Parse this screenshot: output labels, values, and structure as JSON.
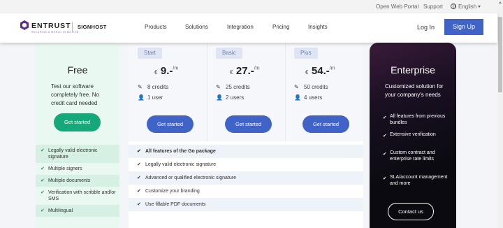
{
  "utility_bar": {
    "open_web_portal": "Open Web Portal",
    "support": "Support",
    "language": "English"
  },
  "header": {
    "brand": "ENTRUST",
    "brand_tagline": "SECURING A WORLD IN MOTION",
    "product": "SIGNHOST",
    "nav": [
      "Products",
      "Solutions",
      "Integration",
      "Pricing",
      "Insights"
    ],
    "login": "Log In",
    "signup": "Sign Up"
  },
  "free_plan": {
    "title": "Free",
    "description": "Test our software completely free. No credit card needed",
    "button": "Get started",
    "features": [
      "Legally valid electronic signature",
      "Multiple signers",
      "Multiple documents",
      "Verification with scribble and/or SMS",
      "Multilingual"
    ]
  },
  "paid_plans": [
    {
      "name": "Start",
      "currency": "€",
      "price": "9.-",
      "period": "/m",
      "credits": "8 credits",
      "users": "1 user",
      "button": "Get started"
    },
    {
      "name": "Basic",
      "currency": "€",
      "price": "27.-",
      "period": "/m",
      "credits": "25 credits",
      "users": "2 users",
      "button": "Get started"
    },
    {
      "name": "Plus",
      "currency": "€",
      "price": "54.-",
      "period": "/m",
      "credits": "50 credits",
      "users": "4 users",
      "button": "Get started"
    }
  ],
  "paid_features": [
    "All features of the Go package",
    "Legally valid electronic signature",
    "Advanced or qualified electronic signature",
    "Customize your branding",
    "Use fillable PDF documents"
  ],
  "enterprise": {
    "title": "Enterprise",
    "description": "Customized solution for your company's needs",
    "features": [
      "All features from previous bundles",
      "Extensive verification",
      "Custom contract and enterprise rate limits",
      "SLA/account management and more"
    ],
    "button": "Contact us"
  },
  "colors": {
    "accent_blue": "#3f63c6",
    "free_green": "#14a87a",
    "free_bg": "#e9f8f1",
    "brand_purple": "#5b2d8e"
  }
}
